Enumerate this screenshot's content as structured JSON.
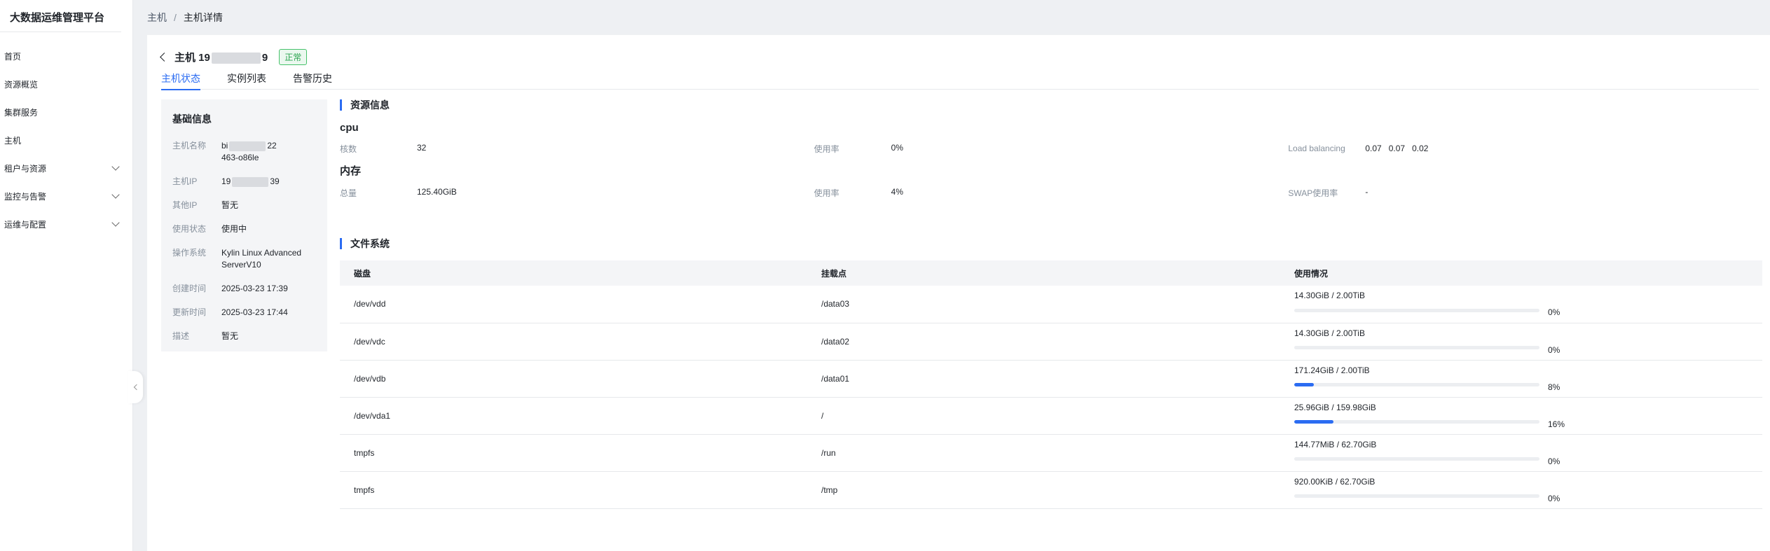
{
  "app": {
    "title": "大数据运维管理平台"
  },
  "sidebar": {
    "items": [
      {
        "label": "首页",
        "expandable": false
      },
      {
        "label": "资源概览",
        "expandable": false
      },
      {
        "label": "集群服务",
        "expandable": false
      },
      {
        "label": "主机",
        "expandable": false
      },
      {
        "label": "租户与资源",
        "expandable": true
      },
      {
        "label": "监控与告警",
        "expandable": true
      },
      {
        "label": "运维与配置",
        "expandable": true
      }
    ]
  },
  "breadcrumb": {
    "parent": "主机",
    "separator": "/",
    "current": "主机详情"
  },
  "host": {
    "title_prefix": "主机 19",
    "title_suffix": "9",
    "status": "正常"
  },
  "tabs": [
    {
      "label": "主机状态",
      "active": true
    },
    {
      "label": "实例列表",
      "active": false
    },
    {
      "label": "告警历史",
      "active": false
    }
  ],
  "basic": {
    "title": "基础信息",
    "fields": {
      "hostname": {
        "label": "主机名称",
        "line1a": "bi",
        "line1b": "22",
        "line2": "463-o86le"
      },
      "ip": {
        "label": "主机IP",
        "prefix": "19",
        "suffix": "39"
      },
      "other_ip": {
        "label": "其他IP",
        "value": "暂无"
      },
      "use_status": {
        "label": "使用状态",
        "value": "使用中"
      },
      "os": {
        "label": "操作系统",
        "value": "Kylin Linux Advanced ServerV10"
      },
      "created": {
        "label": "创建时间",
        "value": "2025-03-23 17:39"
      },
      "updated": {
        "label": "更新时间",
        "value": "2025-03-23 17:44"
      },
      "desc": {
        "label": "描述",
        "value": "暂无"
      }
    }
  },
  "resource": {
    "title": "资源信息",
    "cpu": {
      "title": "cpu",
      "cores_label": "核数",
      "cores": "32",
      "usage_label": "使用率",
      "usage": "0%",
      "lb_label": "Load balancing",
      "lb1": "0.07",
      "lb2": "0.07",
      "lb3": "0.02"
    },
    "memory": {
      "title": "内存",
      "total_label": "总量",
      "total": "125.40GiB",
      "usage_label": "使用率",
      "usage": "4%",
      "swap_label": "SWAP使用率",
      "swap": "-"
    }
  },
  "filesystem": {
    "title": "文件系统",
    "headers": {
      "disk": "磁盘",
      "mount": "挂载点",
      "usage": "使用情况"
    },
    "rows": [
      {
        "disk": "/dev/vdd",
        "mount": "/data03",
        "usage": "14.30GiB / 2.00TiB",
        "pct": "0%",
        "fraction": 0.0
      },
      {
        "disk": "/dev/vdc",
        "mount": "/data02",
        "usage": "14.30GiB / 2.00TiB",
        "pct": "0%",
        "fraction": 0.0
      },
      {
        "disk": "/dev/vdb",
        "mount": "/data01",
        "usage": "171.24GiB / 2.00TiB",
        "pct": "8%",
        "fraction": 0.08
      },
      {
        "disk": "/dev/vda1",
        "mount": "/",
        "usage": "25.96GiB / 159.98GiB",
        "pct": "16%",
        "fraction": 0.16
      },
      {
        "disk": "tmpfs",
        "mount": "/run",
        "usage": "144.77MiB / 62.70GiB",
        "pct": "0%",
        "fraction": 0.0
      },
      {
        "disk": "tmpfs",
        "mount": "/tmp",
        "usage": "920.00KiB / 62.70GiB",
        "pct": "0%",
        "fraction": 0.0
      }
    ]
  }
}
